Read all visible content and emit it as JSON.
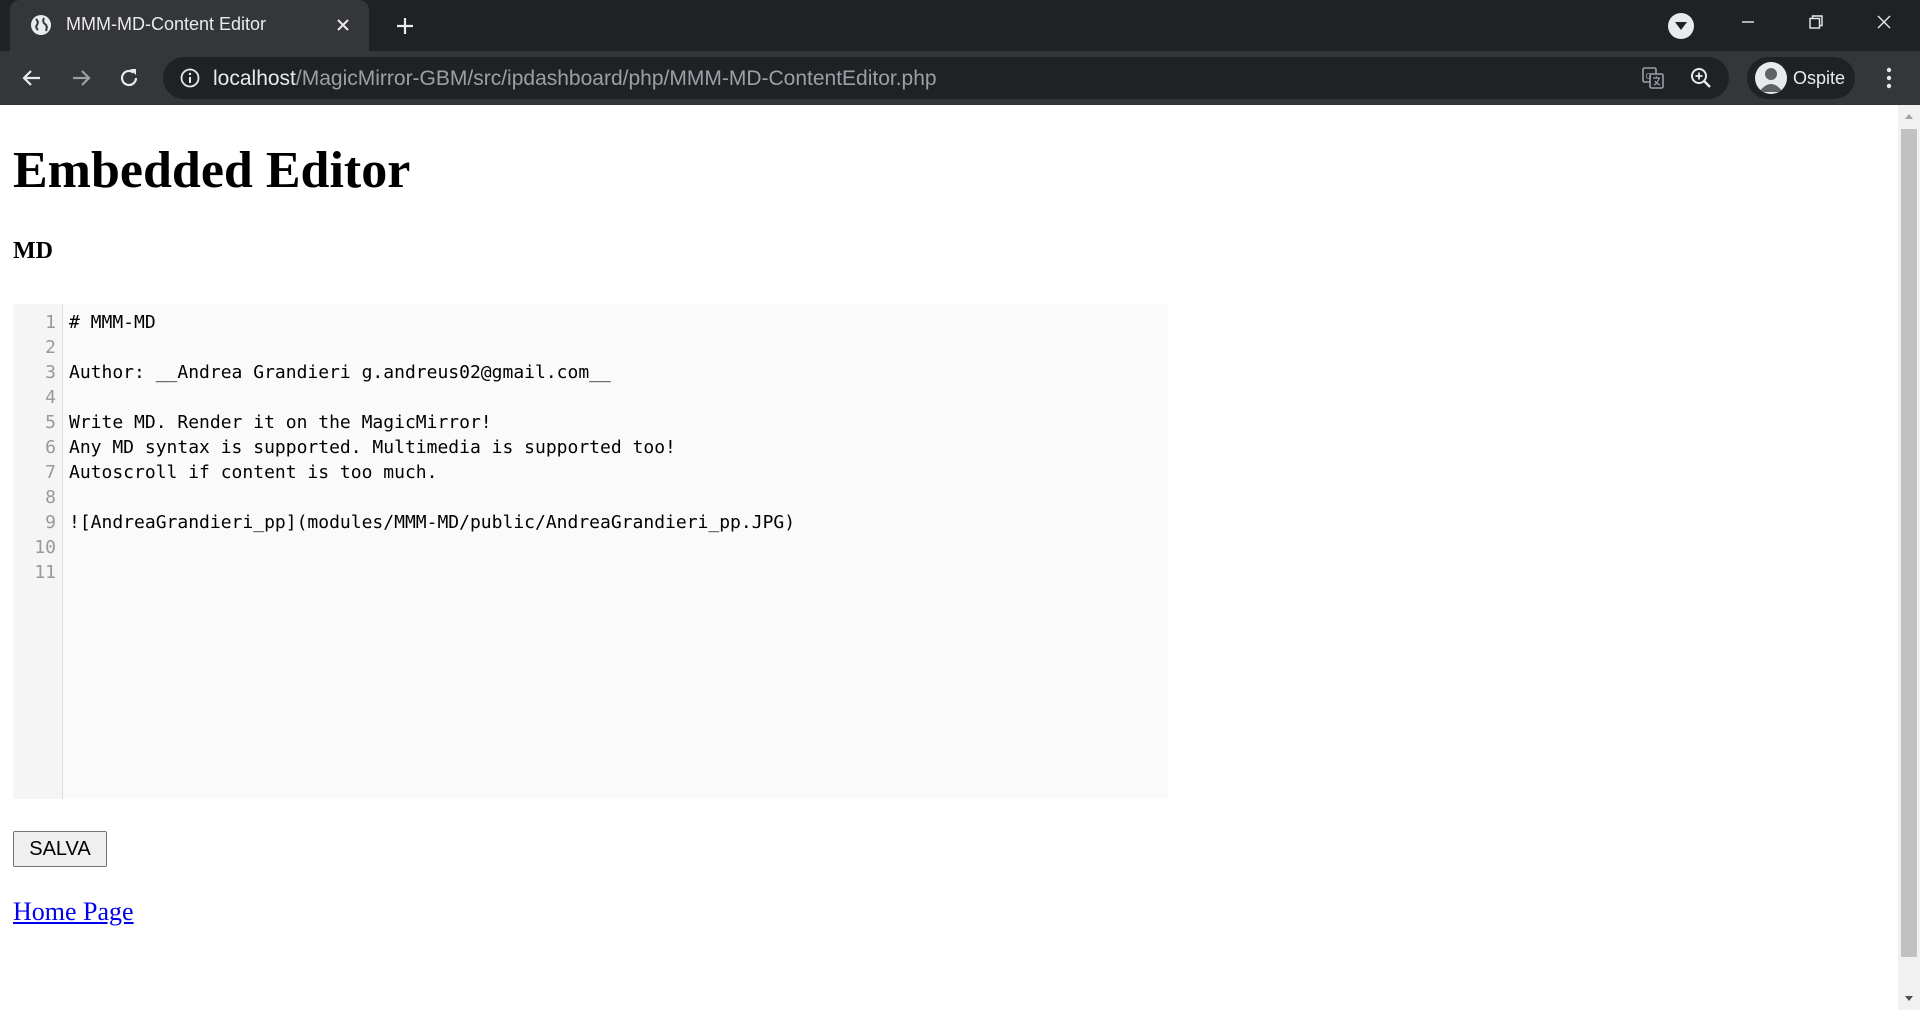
{
  "browser": {
    "tab": {
      "title": "MMM-MD-Content Editor"
    },
    "address_bar": {
      "host": "localhost",
      "path": "/MagicMirror-GBM/src/ipdashboard/php/MMM-MD-ContentEditor.php"
    },
    "profile": {
      "name": "Ospite"
    },
    "icons": {
      "favicon": "globe-icon",
      "tab_close": "close-icon",
      "new_tab": "plus-icon",
      "tab_search": "chevron-down-icon",
      "back": "arrow-left-icon",
      "forward": "arrow-right-icon",
      "reload": "reload-icon",
      "site_info": "info-icon",
      "translate": "translate-icon",
      "zoom": "zoom-in-icon",
      "menu": "kebab-menu-icon"
    },
    "colors": {
      "frame": "#202124",
      "toolbar": "#35363a",
      "text": "#e8eaed",
      "url_path": "#9aa0a6"
    }
  },
  "page": {
    "title": "Embedded Editor",
    "section_title": "MD",
    "editor": {
      "line_numbers": [
        "1",
        "2",
        "3",
        "4",
        "5",
        "6",
        "7",
        "8",
        "9",
        "10",
        "11"
      ],
      "lines": [
        "# MMM-MD",
        "",
        "Author: __Andrea Grandieri g.andreus02@gmail.com__",
        "",
        "Write MD. Render it on the MagicMirror!",
        "Any MD syntax is supported. Multimedia is supported too!",
        "Autoscroll if content is too much.",
        "",
        "![AndreaGrandieri_pp](modules/MMM-MD/public/AndreaGrandieri_pp.JPG)",
        "",
        ""
      ]
    },
    "save_label": "SALVA",
    "home_link": "Home Page",
    "colors": {
      "link": "#0000ee",
      "editor_bg": "#fafafa",
      "gutter_bg": "#f5f5f5"
    }
  }
}
